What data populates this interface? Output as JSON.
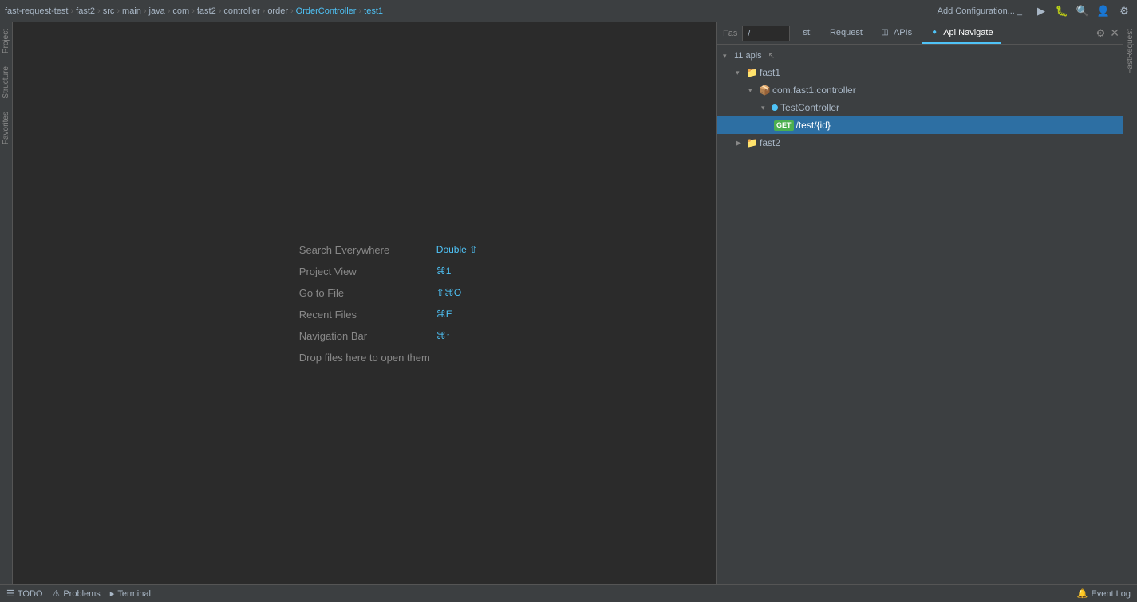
{
  "topBar": {
    "breadcrumbs": [
      {
        "label": "fast-request-test",
        "blue": false
      },
      {
        "label": "fast2",
        "blue": false
      },
      {
        "label": "src",
        "blue": false
      },
      {
        "label": "main",
        "blue": false
      },
      {
        "label": "java",
        "blue": false
      },
      {
        "label": "com",
        "blue": false
      },
      {
        "label": "fast2",
        "blue": false
      },
      {
        "label": "controller",
        "blue": false
      },
      {
        "label": "order",
        "blue": false
      },
      {
        "label": "OrderController",
        "blue": true
      },
      {
        "label": "test1",
        "blue": true
      }
    ],
    "addConfig": "Add Configuration...",
    "separator": "›"
  },
  "editorHints": [
    {
      "label": "Search Everywhere",
      "shortcut": "Double ⇧"
    },
    {
      "label": "Project View",
      "shortcut": "⌘1"
    },
    {
      "label": "Go to File",
      "shortcut": "⇧⌘O"
    },
    {
      "label": "Recent Files",
      "shortcut": "⌘E"
    },
    {
      "label": "Navigation Bar",
      "shortcut": "⌘↑"
    },
    {
      "label": "Drop files here to open them",
      "shortcut": ""
    }
  ],
  "rightPanel": {
    "searchPlaceholder": "/",
    "tabs": [
      {
        "label": "st:",
        "icon": "fast-icon",
        "active": false
      },
      {
        "label": "Request",
        "icon": "",
        "active": false
      },
      {
        "label": "APIs",
        "icon": "apis-icon",
        "active": false
      },
      {
        "label": "Api Navigate",
        "icon": "navigate-icon",
        "active": true
      }
    ],
    "apiCount": "11 apis",
    "tree": {
      "root": [
        {
          "id": "fast1",
          "label": "fast1",
          "type": "folder",
          "expanded": true,
          "children": [
            {
              "id": "com.fast1.controller",
              "label": "com.fast1.controller",
              "type": "package",
              "expanded": true,
              "children": [
                {
                  "id": "TestController",
                  "label": "TestController",
                  "type": "controller",
                  "expanded": true,
                  "children": [
                    {
                      "id": "get-test-id",
                      "label": "/test/{id}",
                      "method": "GET",
                      "selected": true
                    }
                  ]
                }
              ]
            }
          ]
        },
        {
          "id": "fast2",
          "label": "fast2",
          "type": "folder",
          "expanded": false,
          "children": []
        }
      ]
    }
  },
  "bottomBar": {
    "todo": "TODO",
    "problems": "Problems",
    "terminal": "Terminal",
    "eventLog": "Event Log"
  },
  "sideLabels": {
    "project": "Project",
    "structure": "Structure",
    "favorites": "Favorites",
    "fastRequest": "FastRequest"
  }
}
